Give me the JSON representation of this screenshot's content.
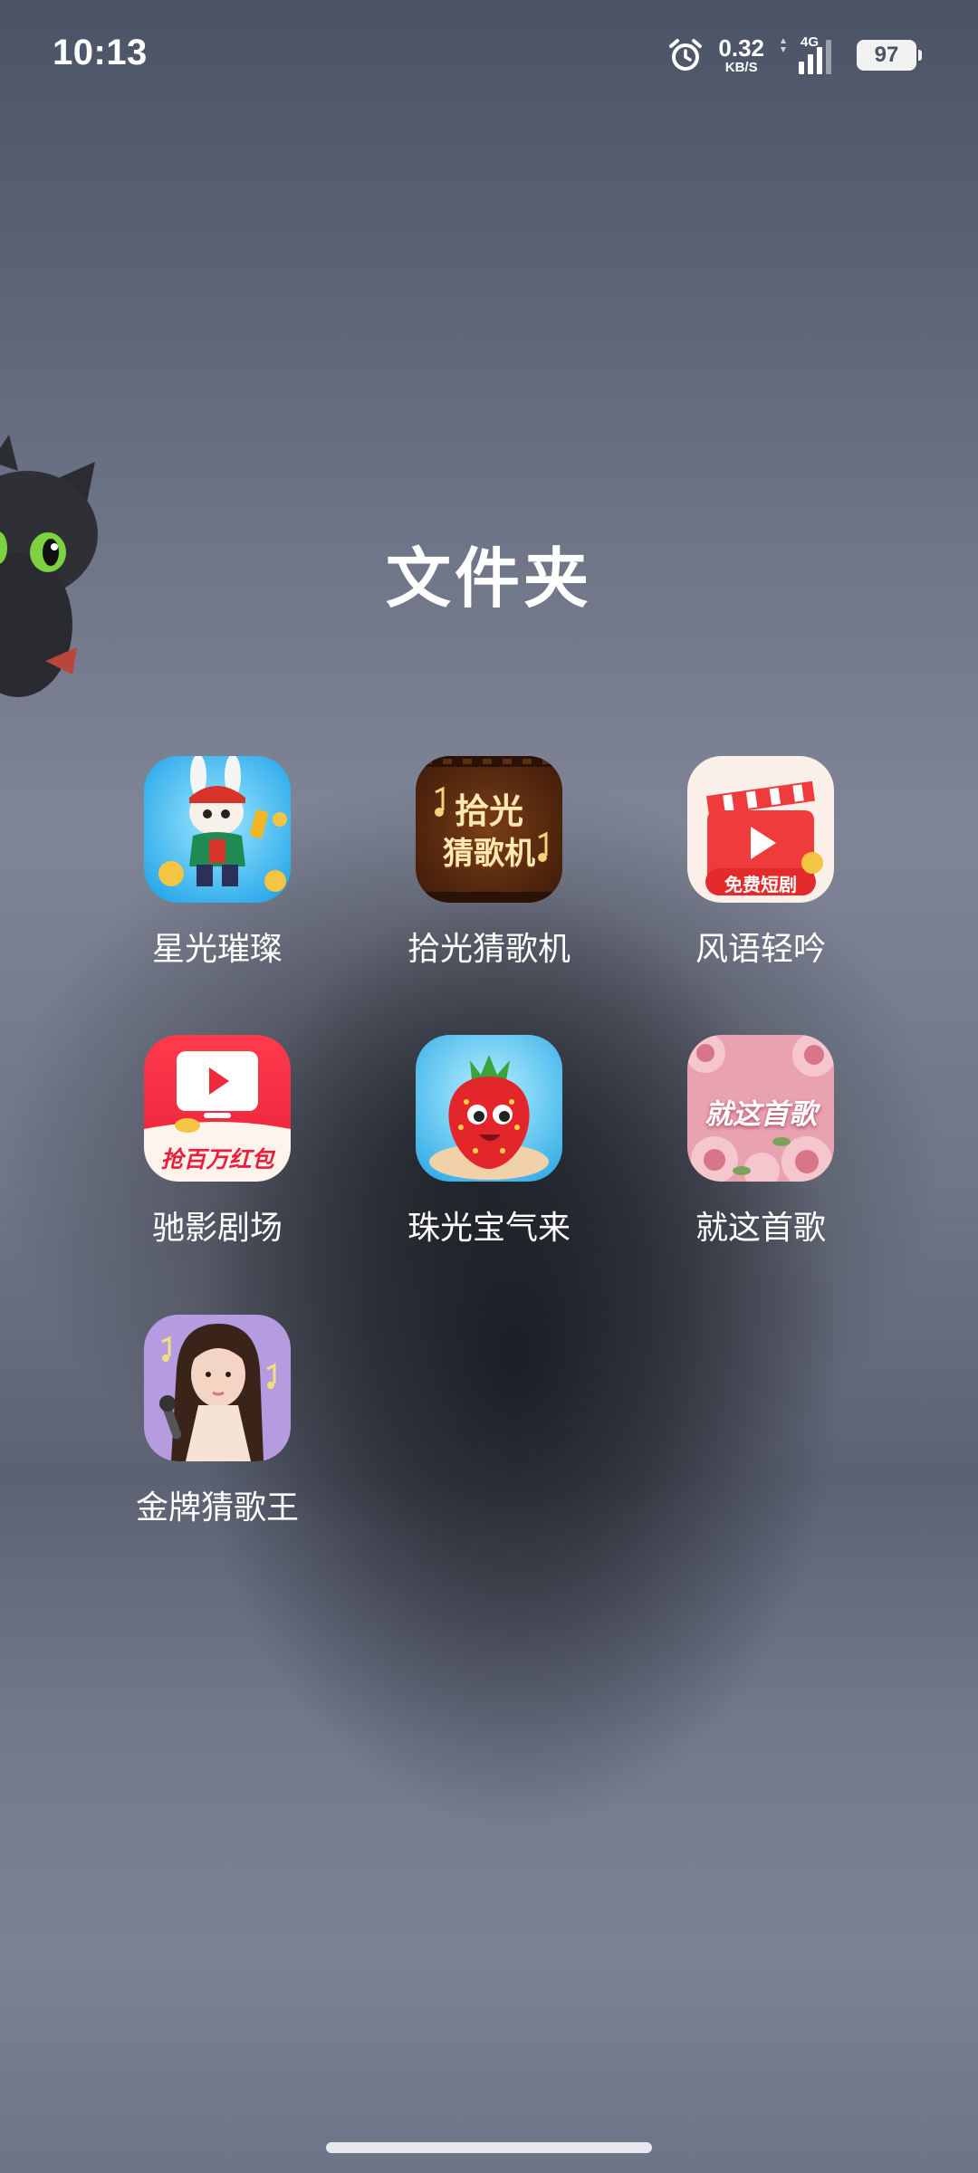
{
  "status_bar": {
    "time": "10:13",
    "net_speed_value": "0.32",
    "net_speed_unit": "KB/S",
    "network_type": "4G",
    "battery": "97",
    "icons": [
      "alarm-icon",
      "signal-icon",
      "battery-icon"
    ]
  },
  "folder": {
    "title": "文件夹",
    "apps": [
      {
        "label": "星光璀璨",
        "icon": "rabbit-game-icon"
      },
      {
        "label": "拾光猜歌机",
        "icon": "song-guess-icon",
        "icon_text": [
          "拾光",
          "猜歌机"
        ]
      },
      {
        "label": "风语轻吟",
        "icon": "short-drama-icon",
        "icon_text": "免费短剧"
      },
      {
        "label": "驰影剧场",
        "icon": "red-envelope-tv-icon",
        "icon_text": "抢百万红包"
      },
      {
        "label": "珠光宝气来",
        "icon": "strawberry-icon"
      },
      {
        "label": "就这首歌",
        "icon": "rose-song-icon",
        "icon_text": "就这首歌"
      },
      {
        "label": "金牌猜歌王",
        "icon": "singer-portrait-icon"
      }
    ]
  },
  "colors": {
    "drama_red": "#ef3b3b",
    "song_brown": "#5a2e14",
    "rose_pink": "#e9a3b0",
    "singer_purple": "#b59be0"
  }
}
